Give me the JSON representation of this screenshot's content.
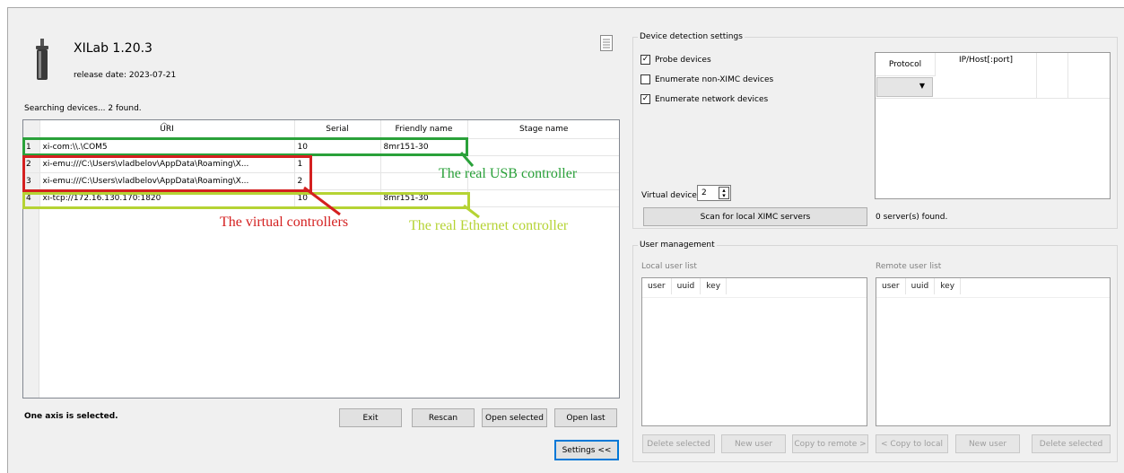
{
  "app": {
    "title": "XILab 1.20.3",
    "release": "release date: 2023-07-21",
    "status": "Searching devices... 2 found."
  },
  "device_table": {
    "columns": [
      "URI",
      "Serial",
      "Friendly name",
      "Stage name"
    ],
    "rows": [
      {
        "num": "1",
        "uri": "xi-com:\\\\.\\COM5",
        "serial": "10",
        "friendly": "8mr151-30",
        "stage": ""
      },
      {
        "num": "2",
        "uri": "xi-emu:///C:\\Users\\vladbelov\\AppData\\Roaming\\X...",
        "serial": "1",
        "friendly": "",
        "stage": ""
      },
      {
        "num": "3",
        "uri": "xi-emu:///C:\\Users\\vladbelov\\AppData\\Roaming\\X...",
        "serial": "2",
        "friendly": "",
        "stage": ""
      },
      {
        "num": "4",
        "uri": "xi-tcp://172.16.130.170:1820",
        "serial": "10",
        "friendly": "8mr151-30",
        "stage": ""
      }
    ]
  },
  "footer": {
    "selection": "One axis is selected.",
    "exit": "Exit",
    "rescan": "Rescan",
    "open_selected": "Open selected",
    "open_last": "Open last",
    "settings": "Settings <<"
  },
  "annotations": {
    "usb": "The real USB controller",
    "virtual": "The virtual controllers",
    "ethernet": "The real Ethernet controller",
    "usb_color": "#2aa13a",
    "virtual_color": "#d42020",
    "ethernet_color": "#b5d334"
  },
  "detection": {
    "title": "Device detection settings",
    "probe": {
      "label": "Probe devices",
      "checked": true
    },
    "enum_nonximc": {
      "label": "Enumerate non-XIMC devices",
      "checked": false
    },
    "enum_network": {
      "label": "Enumerate network devices",
      "checked": true
    },
    "virtual_label": "Virtual devices",
    "virtual_value": "2",
    "scan_button": "Scan for local XIMC servers",
    "servers_found": "0 server(s) found.",
    "columns": [
      "Protocol",
      "IP/Host[:port]"
    ]
  },
  "users": {
    "title": "User management",
    "local_label": "Local user list",
    "remote_label": "Remote user list",
    "columns": [
      "user",
      "uuid",
      "key"
    ],
    "local_buttons": [
      "Delete selected",
      "New user",
      "Copy to remote >"
    ],
    "remote_buttons": [
      "< Copy to local",
      "New user",
      "Delete selected"
    ]
  }
}
